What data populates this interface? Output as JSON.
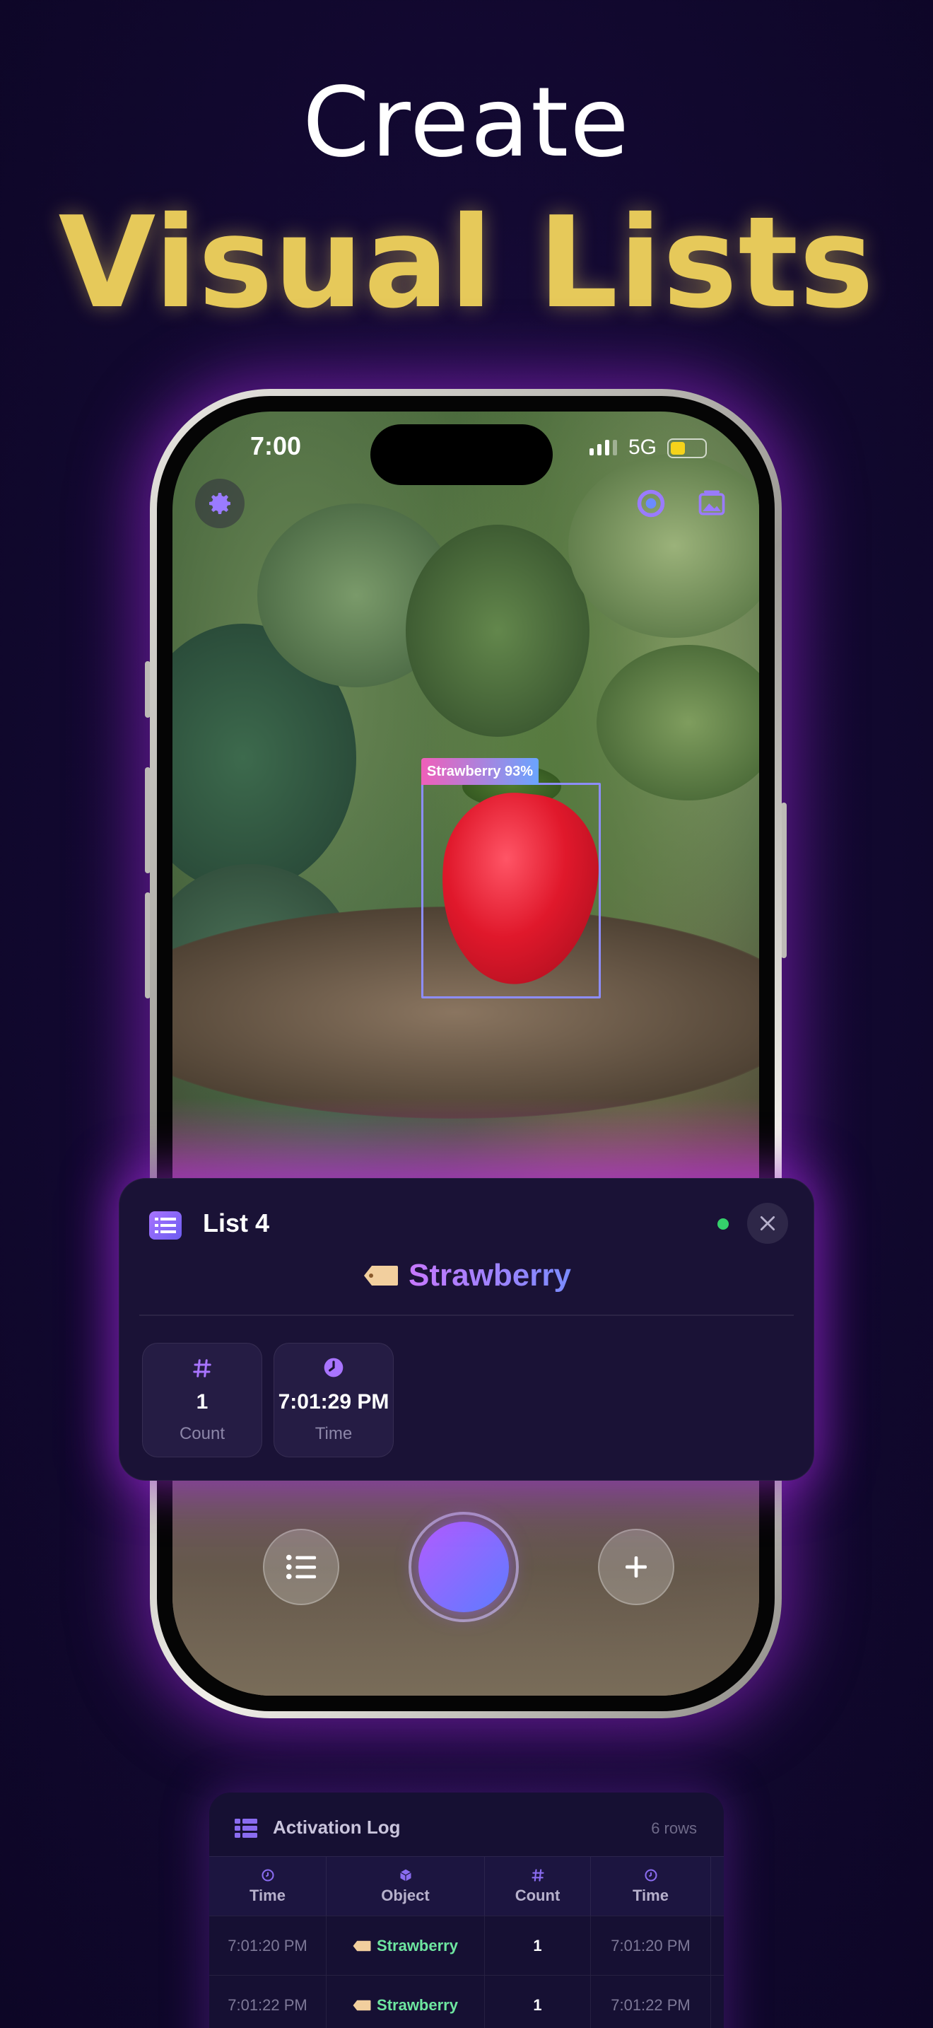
{
  "headline": {
    "line1": "Create",
    "line2": "Visual Lists"
  },
  "status_bar": {
    "time": "7:00",
    "network": "5G"
  },
  "detection": {
    "label": "Strawberry 93%"
  },
  "list_card": {
    "title": "List 4",
    "object_name": "Strawberry",
    "stats": [
      {
        "value": "1",
        "label": "Count",
        "icon": "hash-icon"
      },
      {
        "value": "7:01:29 PM",
        "label": "Time",
        "icon": "clock-icon"
      }
    ]
  },
  "controls": {
    "left": "list-icon",
    "center": "shutter",
    "right": "plus-icon"
  },
  "log": {
    "title": "Activation Log",
    "rows_count": "6 rows",
    "headers": [
      "Time",
      "Object",
      "Count",
      "Time"
    ],
    "rows": [
      {
        "time": "7:01:20 PM",
        "object": "Strawberry",
        "count": "1",
        "time2": "7:01:20 PM"
      },
      {
        "time": "7:01:22 PM",
        "object": "Strawberry",
        "count": "1",
        "time2": "7:01:22 PM"
      }
    ]
  },
  "colors": {
    "accent_gold": "#e6c95a",
    "accent_purple": "#a874ff",
    "glow": "#a028dc",
    "live": "#35d06b"
  }
}
